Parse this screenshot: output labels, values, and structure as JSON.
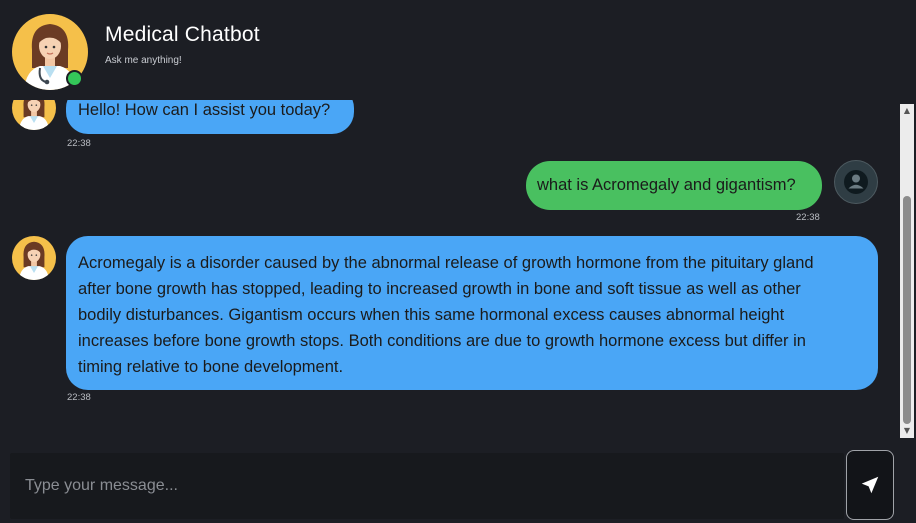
{
  "header": {
    "title": "Medical Chatbot",
    "subtitle": "Ask me anything!",
    "online_color": "#34c759",
    "avatar_icon": "doctor-avatar-icon"
  },
  "messages": [
    {
      "sender": "bot",
      "text": "Hello! How can I assist you today?",
      "time": "22:38"
    },
    {
      "sender": "user",
      "text": "what is Acromegaly and gigantism?",
      "time": "22:38"
    },
    {
      "sender": "bot",
      "lines": [
        "Acromegaly is a disorder caused by the abnormal release of growth hormone from the pituitary gland",
        "after bone growth has stopped, leading to increased growth in bone and soft tissue as well as other",
        "bodily disturbances. Gigantism occurs when this same hormonal excess causes abnormal height",
        "increases before bone growth stops. Both conditions are due to growth hormone excess but differ in",
        "timing relative to bone development."
      ],
      "time": "22:38"
    }
  ],
  "input": {
    "placeholder": "Type your message..."
  },
  "send": {
    "icon": "send-icon"
  },
  "colors": {
    "bot_bubble": "#4aa6f6",
    "user_bubble": "#49c060",
    "background": "#1c1e24"
  }
}
